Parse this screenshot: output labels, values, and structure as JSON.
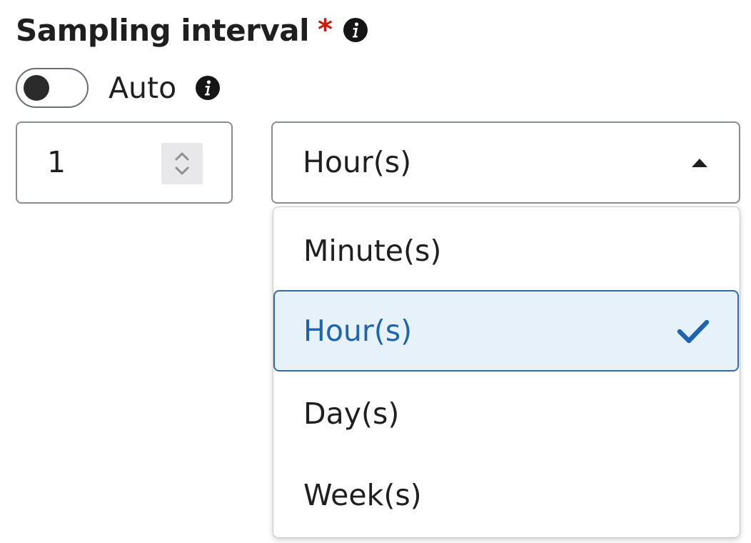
{
  "field": {
    "label": "Sampling interval",
    "required_marker": "*",
    "label_info_icon": "info-circle-icon"
  },
  "auto_toggle": {
    "label": "Auto",
    "state": "off",
    "info_icon": "info-circle-icon"
  },
  "interval_value": {
    "value": "1",
    "stepper_icon": "up-down-chevron-icon"
  },
  "unit_select": {
    "selected": "Hour(s)",
    "expanded": true,
    "toggle_icon": "caret-up-icon",
    "options": [
      {
        "label": "Minute(s)",
        "selected": false
      },
      {
        "label": "Hour(s)",
        "selected": true
      },
      {
        "label": "Day(s)",
        "selected": false
      },
      {
        "label": "Week(s)",
        "selected": false
      }
    ],
    "selected_icon": "check-icon"
  },
  "colors": {
    "required": "#c9190b",
    "selected_text": "#1f65ad",
    "selected_bg": "#e7f1fa",
    "selected_border": "#2b6cb0",
    "text": "#1f1f1f"
  }
}
